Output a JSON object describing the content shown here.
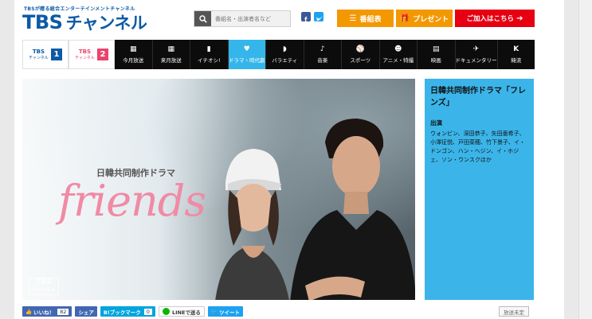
{
  "header": {
    "tagline": "TBSが贈る総合エンターテインメントチャンネル",
    "logo": "TBS",
    "logo_sub": "チャンネル",
    "search_placeholder": "番組名・出演者名など",
    "buttons": {
      "schedule": "番組表",
      "present": "プレゼント",
      "subscribe": "ご加入はこちら"
    }
  },
  "nav": {
    "channels": [
      {
        "label": "TBS",
        "sub": "チャンネル",
        "num": "1"
      },
      {
        "label": "TBS",
        "sub": "チャンネル",
        "num": "2"
      }
    ],
    "categories": [
      {
        "label": "今月放送",
        "icon": "calendar-icon"
      },
      {
        "label": "来月放送",
        "icon": "calendar-next-icon"
      },
      {
        "label": "イチオシ!",
        "icon": "bottle-icon"
      },
      {
        "label": "ドラマ・時代劇",
        "icon": "heart-icon"
      },
      {
        "label": "バラエティ",
        "icon": "variety-icon"
      },
      {
        "label": "音楽",
        "icon": "music-icon"
      },
      {
        "label": "スポーツ",
        "icon": "sports-icon"
      },
      {
        "label": "アニメ・特撮",
        "icon": "anime-icon"
      },
      {
        "label": "映画",
        "icon": "film-icon"
      },
      {
        "label": "ドキュメンタリー",
        "icon": "plane-icon"
      },
      {
        "label": "韓流",
        "icon": "k-icon"
      }
    ],
    "active": "ドラマ・時代劇"
  },
  "hero": {
    "subtitle": "日韓共同制作ドラマ",
    "title": "friends",
    "watermark": "TBS",
    "watermark_sub": "チャンネル"
  },
  "info": {
    "title": "日韓共同制作ドラマ「フレンズ」",
    "cast_label": "出演",
    "cast": "ウォンビン、深田恭子、矢田亜希子、小澤征悦、戸田菜穂、竹下景子、イ・ドンゴン、ハン・ヘジン、イ・ホジェ、ソン・ウンスクほか"
  },
  "share": {
    "like": "いいね！",
    "like_count": "82",
    "share": "シェア",
    "hatena": "B!ブックマーク",
    "hatena_count": "0",
    "line": "LINEで送る",
    "tweet": "ツイート"
  },
  "status": "放送未定",
  "colors": {
    "brand_blue": "#0c5aa6",
    "accent_cyan": "#3bb5e9",
    "orange": "#f39800",
    "red": "#e60012"
  }
}
